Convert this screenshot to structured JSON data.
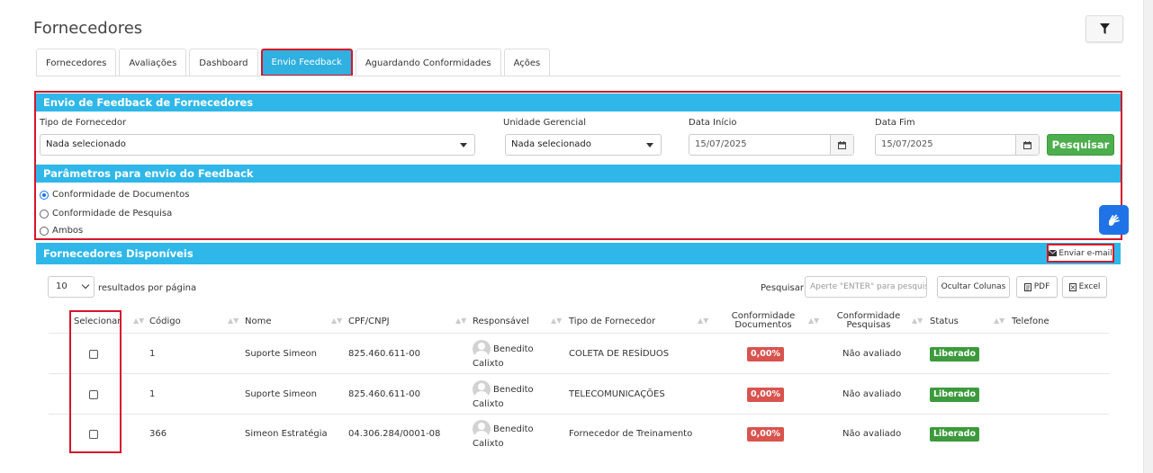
{
  "page": {
    "title": "Fornecedores"
  },
  "tabs": [
    {
      "label": "Fornecedores",
      "active": false
    },
    {
      "label": "Avaliações",
      "active": false
    },
    {
      "label": "Dashboard",
      "active": false
    },
    {
      "label": "Envio Feedback",
      "active": true
    },
    {
      "label": "Aguardando Conformidades",
      "active": false
    },
    {
      "label": "Ações",
      "active": false
    }
  ],
  "feedback": {
    "header": "Envio de Feedback de Fornecedores",
    "tipo_label": "Tipo de Fornecedor",
    "tipo_value": "Nada selecionado",
    "unidade_label": "Unidade Gerencial",
    "unidade_value": "Nada selecionado",
    "data_inicio_label": "Data Início",
    "data_inicio_value": "15/07/2025",
    "data_fim_label": "Data Fim",
    "data_fim_value": "15/07/2025",
    "pesquisar_label": "Pesquisar"
  },
  "params": {
    "header": "Parâmetros para envio do Feedback",
    "options": [
      {
        "label": "Conformidade de Documentos",
        "selected": true
      },
      {
        "label": "Conformidade de Pesquisa",
        "selected": false
      },
      {
        "label": "Ambos",
        "selected": false
      }
    ]
  },
  "list": {
    "header": "Fornecedores Disponíveis",
    "email_button": "Enviar e-mail",
    "page_length": "10",
    "page_length_suffix": "resultados por página",
    "search_label": "Pesquisar",
    "search_placeholder": "Aperte \"ENTER\" para pesquisar",
    "hide_columns_button": "Ocultar Colunas",
    "pdf_button": "PDF",
    "excel_button": "Excel"
  },
  "table": {
    "columns": {
      "selecionar": "Selecionar",
      "codigo": "Código",
      "nome": "Nome",
      "cpf": "CPF/CNPJ",
      "responsavel": "Responsável",
      "tipo": "Tipo de Fornecedor",
      "conf_doc": "Conformidade Documentos",
      "conf_pesq": "Conformidade Pesquisas",
      "status": "Status",
      "telefone": "Telefone"
    },
    "rows": [
      {
        "codigo": "1",
        "nome": "Suporte Simeon",
        "cpf": "825.460.611-00",
        "resp_first": "Benedito",
        "resp_last": "Calixto",
        "tipo": "COLETA DE RESÍDUOS",
        "conf_doc": "0,00%",
        "conf_pesq": "Não avaliado",
        "status": "Liberado",
        "telefone": ""
      },
      {
        "codigo": "1",
        "nome": "Suporte Simeon",
        "cpf": "825.460.611-00",
        "resp_first": "Benedito",
        "resp_last": "Calixto",
        "tipo": "TELECOMUNICAÇÕES",
        "conf_doc": "0,00%",
        "conf_pesq": "Não avaliado",
        "status": "Liberado",
        "telefone": ""
      },
      {
        "codigo": "366",
        "nome": "Simeon Estratégia",
        "cpf": "04.306.284/0001-08",
        "resp_first": "Benedito",
        "resp_last": "Calixto",
        "tipo": "Fornecedor de Treinamento",
        "conf_doc": "0,00%",
        "conf_pesq": "Não avaliado",
        "status": "Liberado",
        "telefone": ""
      }
    ]
  },
  "colors": {
    "accent": "#2fb7e9",
    "highlight": "#d6152a",
    "success": "#4cae4c",
    "danger": "#d9534f"
  }
}
